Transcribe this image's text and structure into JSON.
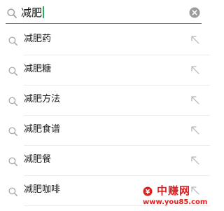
{
  "search": {
    "query": "减肥",
    "search_icon": "search-icon",
    "clear_icon": "clear-icon",
    "accent_color": "#2aae67"
  },
  "suggestions": [
    {
      "label": "减肥药",
      "icon": "search-icon",
      "action_icon": "arrow-up-left-icon"
    },
    {
      "label": "减肥糖",
      "icon": "search-icon",
      "action_icon": "arrow-up-left-icon"
    },
    {
      "label": "减肥方法",
      "icon": "search-icon",
      "action_icon": "arrow-up-left-icon"
    },
    {
      "label": "减肥食谱",
      "icon": "search-icon",
      "action_icon": "arrow-up-left-icon"
    },
    {
      "label": "减肥餐",
      "icon": "search-icon",
      "action_icon": "arrow-up-left-icon"
    },
    {
      "label": "减肥咖啡",
      "icon": "search-icon",
      "action_icon": "arrow-up-left-icon"
    }
  ],
  "watermark": {
    "title": "中赚网",
    "url": "www.you85.com",
    "color": "#e02020"
  }
}
